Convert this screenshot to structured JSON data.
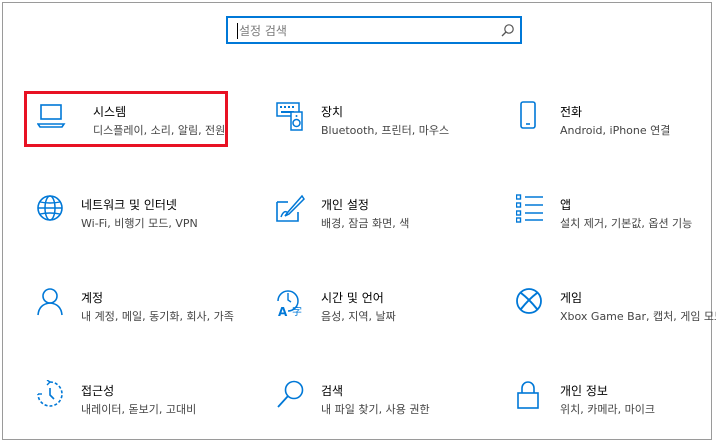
{
  "search": {
    "placeholder": "설정 검색",
    "icon": "search-icon"
  },
  "categories": [
    {
      "title": "시스템",
      "subtitle": "디스플레이, 소리, 알림, 전원",
      "icon": "laptop-icon"
    },
    {
      "title": "장치",
      "subtitle": "Bluetooth, 프린터, 마우스",
      "icon": "devices-icon"
    },
    {
      "title": "전화",
      "subtitle": "Android, iPhone 연결",
      "icon": "phone-icon"
    },
    {
      "title": "네트워크 및 인터넷",
      "subtitle": "Wi-Fi, 비행기 모드, VPN",
      "icon": "globe-icon"
    },
    {
      "title": "개인 설정",
      "subtitle": "배경, 잠금 화면, 색",
      "icon": "personalization-icon"
    },
    {
      "title": "앱",
      "subtitle": "설치 제거, 기본값, 옵션 기능",
      "icon": "apps-list-icon"
    },
    {
      "title": "계정",
      "subtitle": "내 계정, 메일, 동기화, 회사, 가족",
      "icon": "person-icon"
    },
    {
      "title": "시간 및 언어",
      "subtitle": "음성, 지역, 날짜",
      "icon": "time-language-icon"
    },
    {
      "title": "게임",
      "subtitle": "Xbox Game Bar, 캡처, 게임 모드",
      "icon": "xbox-icon"
    },
    {
      "title": "접근성",
      "subtitle": "내레이터, 돋보기, 고대비",
      "icon": "accessibility-icon"
    },
    {
      "title": "검색",
      "subtitle": "내 파일 찾기, 사용 권한",
      "icon": "search-icon"
    },
    {
      "title": "개인 정보",
      "subtitle": "위치, 카메라, 마이크",
      "icon": "lock-icon"
    }
  ],
  "colors": {
    "accent": "#0078d7",
    "highlight": "#e81123"
  }
}
